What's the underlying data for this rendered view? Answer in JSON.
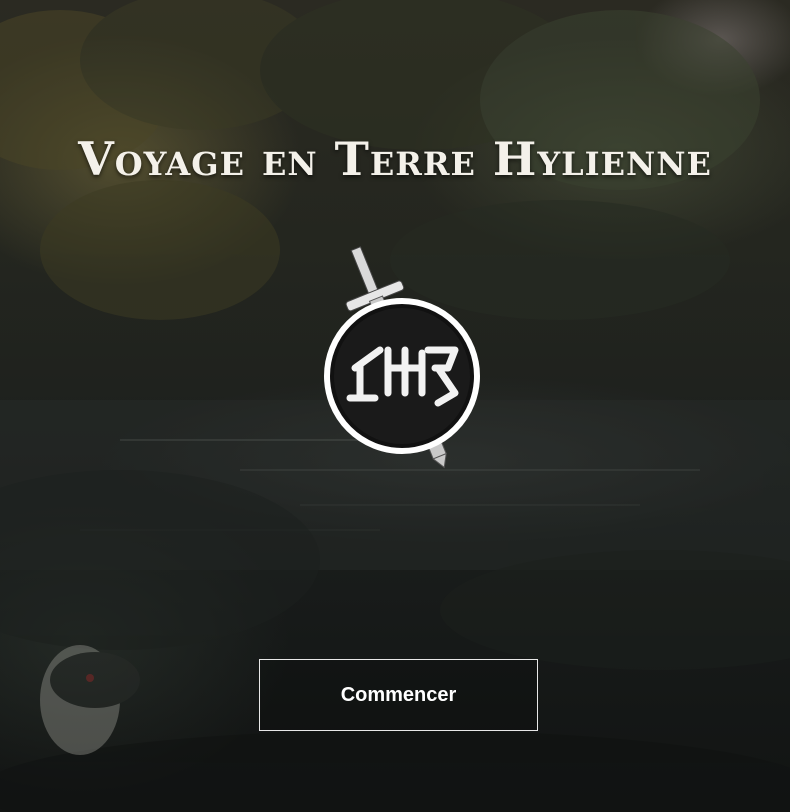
{
  "title": "Voyage en Terre Hylienne",
  "emblem": {
    "icon": "sword-and-hylian-seal-icon",
    "glyph": "ꝺꝺ"
  },
  "actions": {
    "start_label": "Commencer"
  },
  "colors": {
    "text": "#f4f1ea",
    "button_border": "#e8e8e8",
    "background_dark": "#161918"
  }
}
